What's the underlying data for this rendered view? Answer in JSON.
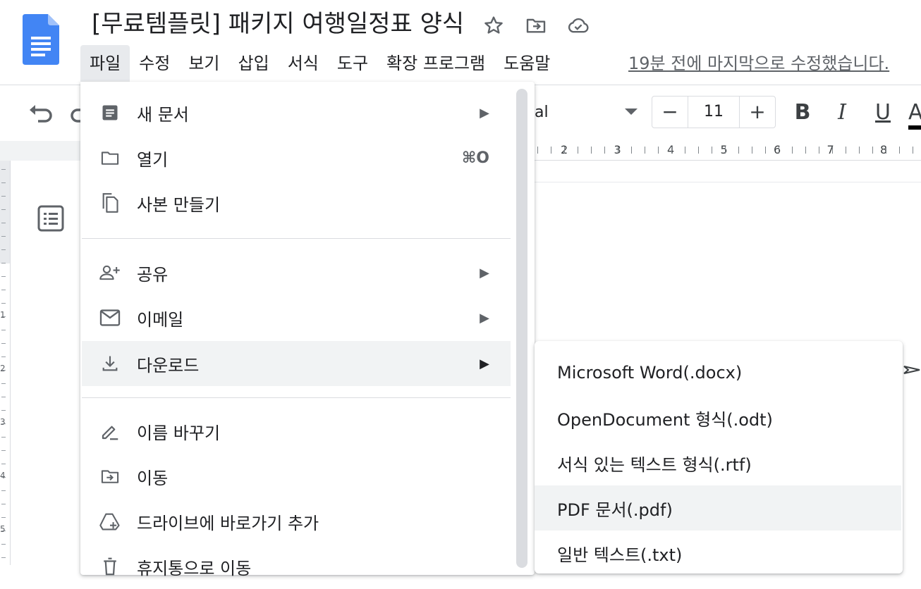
{
  "document": {
    "title": "[무료템플릿] 패키지 여행일정표 양식",
    "title_icons": [
      "star-icon",
      "move-folder-icon",
      "cloud-saved-icon"
    ],
    "last_edit": "19분 전에 마지막으로 수정했습니다."
  },
  "menubar": {
    "items": [
      {
        "label": "파일",
        "active": true
      },
      {
        "label": "수정"
      },
      {
        "label": "보기"
      },
      {
        "label": "삽입"
      },
      {
        "label": "서식"
      },
      {
        "label": "도구"
      },
      {
        "label": "확장 프로그램"
      },
      {
        "label": "도움말"
      }
    ]
  },
  "toolbar": {
    "font_name": "al",
    "font_size": "11",
    "minus": "−",
    "plus": "+",
    "bold": "B",
    "italic": "I",
    "underline": "U",
    "text_color": "A"
  },
  "ruler": {
    "numbers": [
      "2",
      "3",
      "4",
      "5",
      "6",
      "7",
      "8"
    ],
    "vertical_numbers": [
      "1",
      "2",
      "3",
      "4",
      "5"
    ]
  },
  "file_menu": {
    "items": [
      {
        "label": "새 문서",
        "icon": "document-icon",
        "submenu": true
      },
      {
        "label": "열기",
        "icon": "folder-icon",
        "shortcut": "⌘O"
      },
      {
        "label": "사본 만들기",
        "icon": "copy-icon"
      },
      {
        "label": "공유",
        "icon": "person-add-icon",
        "submenu": true
      },
      {
        "label": "이메일",
        "icon": "mail-icon",
        "submenu": true
      },
      {
        "label": "다운로드",
        "icon": "download-icon",
        "submenu": true,
        "highlighted": true
      },
      {
        "label": "이름 바꾸기",
        "icon": "rename-icon"
      },
      {
        "label": "이동",
        "icon": "move-folder-icon"
      },
      {
        "label": "드라이브에 바로가기 추가",
        "icon": "drive-shortcut-icon"
      },
      {
        "label": "휴지통으로 이동",
        "icon": "trash-icon"
      }
    ],
    "submenu_arrow": "▶"
  },
  "download_menu": {
    "items": [
      {
        "label": "Microsoft Word(.docx)"
      },
      {
        "label": "OpenDocument 형식(.odt)"
      },
      {
        "label": "서식 있는 텍스트 형식(.rtf)"
      },
      {
        "label": "PDF 문서(.pdf)",
        "highlighted": true
      },
      {
        "label": "일반 텍스트(.txt)"
      }
    ]
  },
  "colors": {
    "docs_blue": "#4285f4",
    "menu_hover": "#f1f3f4",
    "divider": "#dadce0",
    "text": "#202124",
    "muted": "#5f6368"
  }
}
